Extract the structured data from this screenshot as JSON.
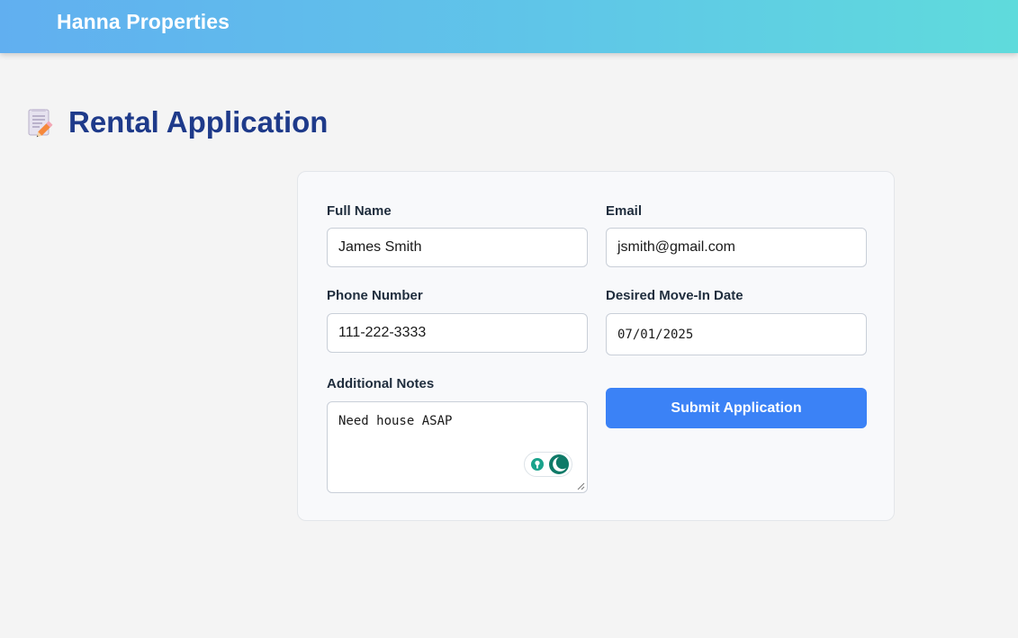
{
  "header": {
    "brand": "Hanna Properties"
  },
  "page": {
    "title": "Rental Application",
    "title_icon": "memo-pencil-icon"
  },
  "form": {
    "full_name": {
      "label": "Full Name",
      "value": "James Smith"
    },
    "email": {
      "label": "Email",
      "value": "jsmith@gmail.com"
    },
    "phone": {
      "label": "Phone Number",
      "value": "111-222-3333"
    },
    "move_in_date": {
      "label": "Desired Move-In Date",
      "value": "07/01/2025"
    },
    "notes": {
      "label": "Additional Notes",
      "value": "Need house ASAP"
    },
    "submit_label": "Submit Application"
  },
  "colors": {
    "title": "#1e3a8a",
    "button": "#3b82f6",
    "header_gradient_start": "#61aff0",
    "header_gradient_end": "#5fdbdc"
  }
}
